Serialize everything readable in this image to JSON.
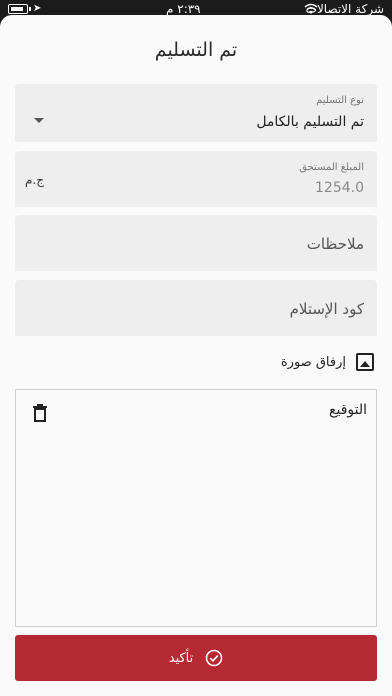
{
  "status_bar": {
    "carrier": "شركة الاتصالات",
    "time": "٢:٣٩ م"
  },
  "title": "تم التسليم",
  "delivery_type": {
    "label": "نوع التسليم",
    "value": "تم التسليم بالكامل"
  },
  "amount_due": {
    "label": "المبلغ المستحق",
    "value": "1254.0",
    "currency": "ج.م"
  },
  "notes": {
    "placeholder": "ملاحظات"
  },
  "receipt_code": {
    "placeholder": "كود الإستلام"
  },
  "attach_image": {
    "label": "إرفاق صورة",
    "icon": "image-icon"
  },
  "signature": {
    "label": "التوقيع",
    "clear_icon": "trash-icon"
  },
  "confirm_button": {
    "label": "تأكيد",
    "icon": "check-circle-icon",
    "color": "#b52932"
  }
}
